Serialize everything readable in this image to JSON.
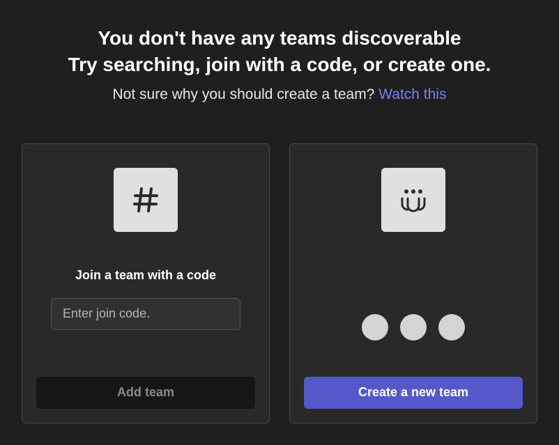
{
  "header": {
    "line1": "You don't have any teams discoverable",
    "line2": "Try searching, join with a code, or create one.",
    "sub_prefix": "Not sure why you should create a team? ",
    "sub_link": "Watch this"
  },
  "join_card": {
    "icon": "hash-icon",
    "title": "Join a team with a code",
    "placeholder": "Enter join code.",
    "button_label": "Add team",
    "button_enabled": false
  },
  "create_card": {
    "icon": "people-icon",
    "button_label": "Create a new team"
  },
  "colors": {
    "accent": "#5558c8",
    "link": "#7a7ff5",
    "bg": "#1f1f1f",
    "card_bg": "#292929"
  }
}
